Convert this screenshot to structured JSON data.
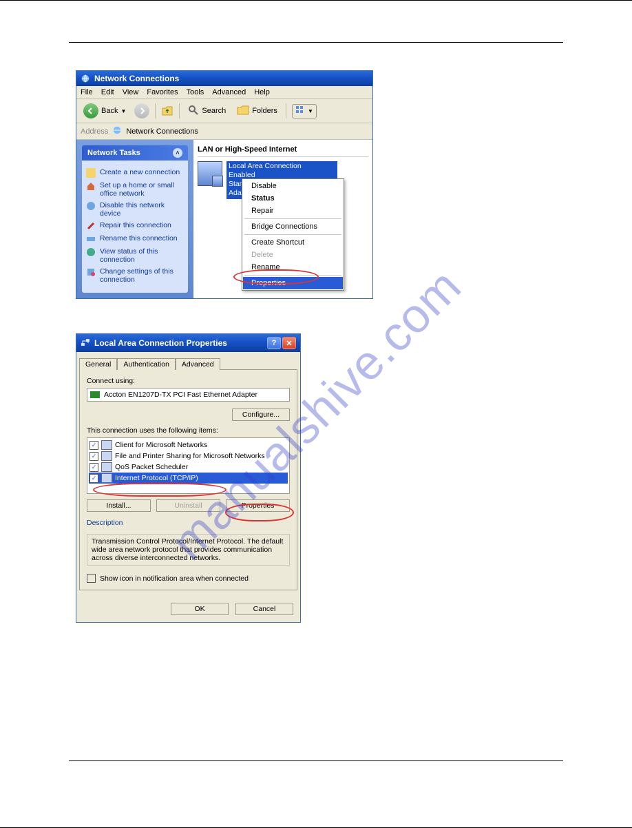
{
  "watermark": "manualshive.com",
  "win1": {
    "title": "Network Connections",
    "menus": [
      "File",
      "Edit",
      "View",
      "Favorites",
      "Tools",
      "Advanced",
      "Help"
    ],
    "toolbar": {
      "back": "Back",
      "search": "Search",
      "folders": "Folders"
    },
    "addressLabel": "Address",
    "addressValue": "Network Connections",
    "tasksHeader": "Network Tasks",
    "tasks": [
      "Create a new connection",
      "Set up a home or small office network",
      "Disable this network device",
      "Repair this connection",
      "Rename this connection",
      "View status of this connection",
      "Change settings of this connection"
    ],
    "groupHeader": "LAN or High-Speed Internet",
    "conn": {
      "name": "Local Area Connection",
      "status": "Enabled",
      "adapter": "Standard PCI Fast Ethernet Adapter"
    },
    "context": {
      "disable": "Disable",
      "status": "Status",
      "repair": "Repair",
      "bridge": "Bridge Connections",
      "shortcut": "Create Shortcut",
      "delete": "Delete",
      "rename": "Rename",
      "properties": "Properties"
    }
  },
  "win2": {
    "title": "Local Area Connection Properties",
    "tabs": {
      "general": "General",
      "auth": "Authentication",
      "adv": "Advanced"
    },
    "connectUsing": "Connect using:",
    "adapter": "Accton EN1207D-TX PCI Fast Ethernet Adapter",
    "configure": "Configure...",
    "itemsLabel": "This connection uses the following items:",
    "items": [
      "Client for Microsoft Networks",
      "File and Printer Sharing for Microsoft Networks",
      "QoS Packet Scheduler",
      "Internet Protocol (TCP/IP)"
    ],
    "install": "Install...",
    "uninstall": "Uninstall",
    "properties": "Properties",
    "descLabel": "Description",
    "descText": "Transmission Control Protocol/Internet Protocol. The default wide area network protocol that provides communication across diverse interconnected networks.",
    "showIcon": "Show icon in notification area when connected",
    "ok": "OK",
    "cancel": "Cancel"
  }
}
